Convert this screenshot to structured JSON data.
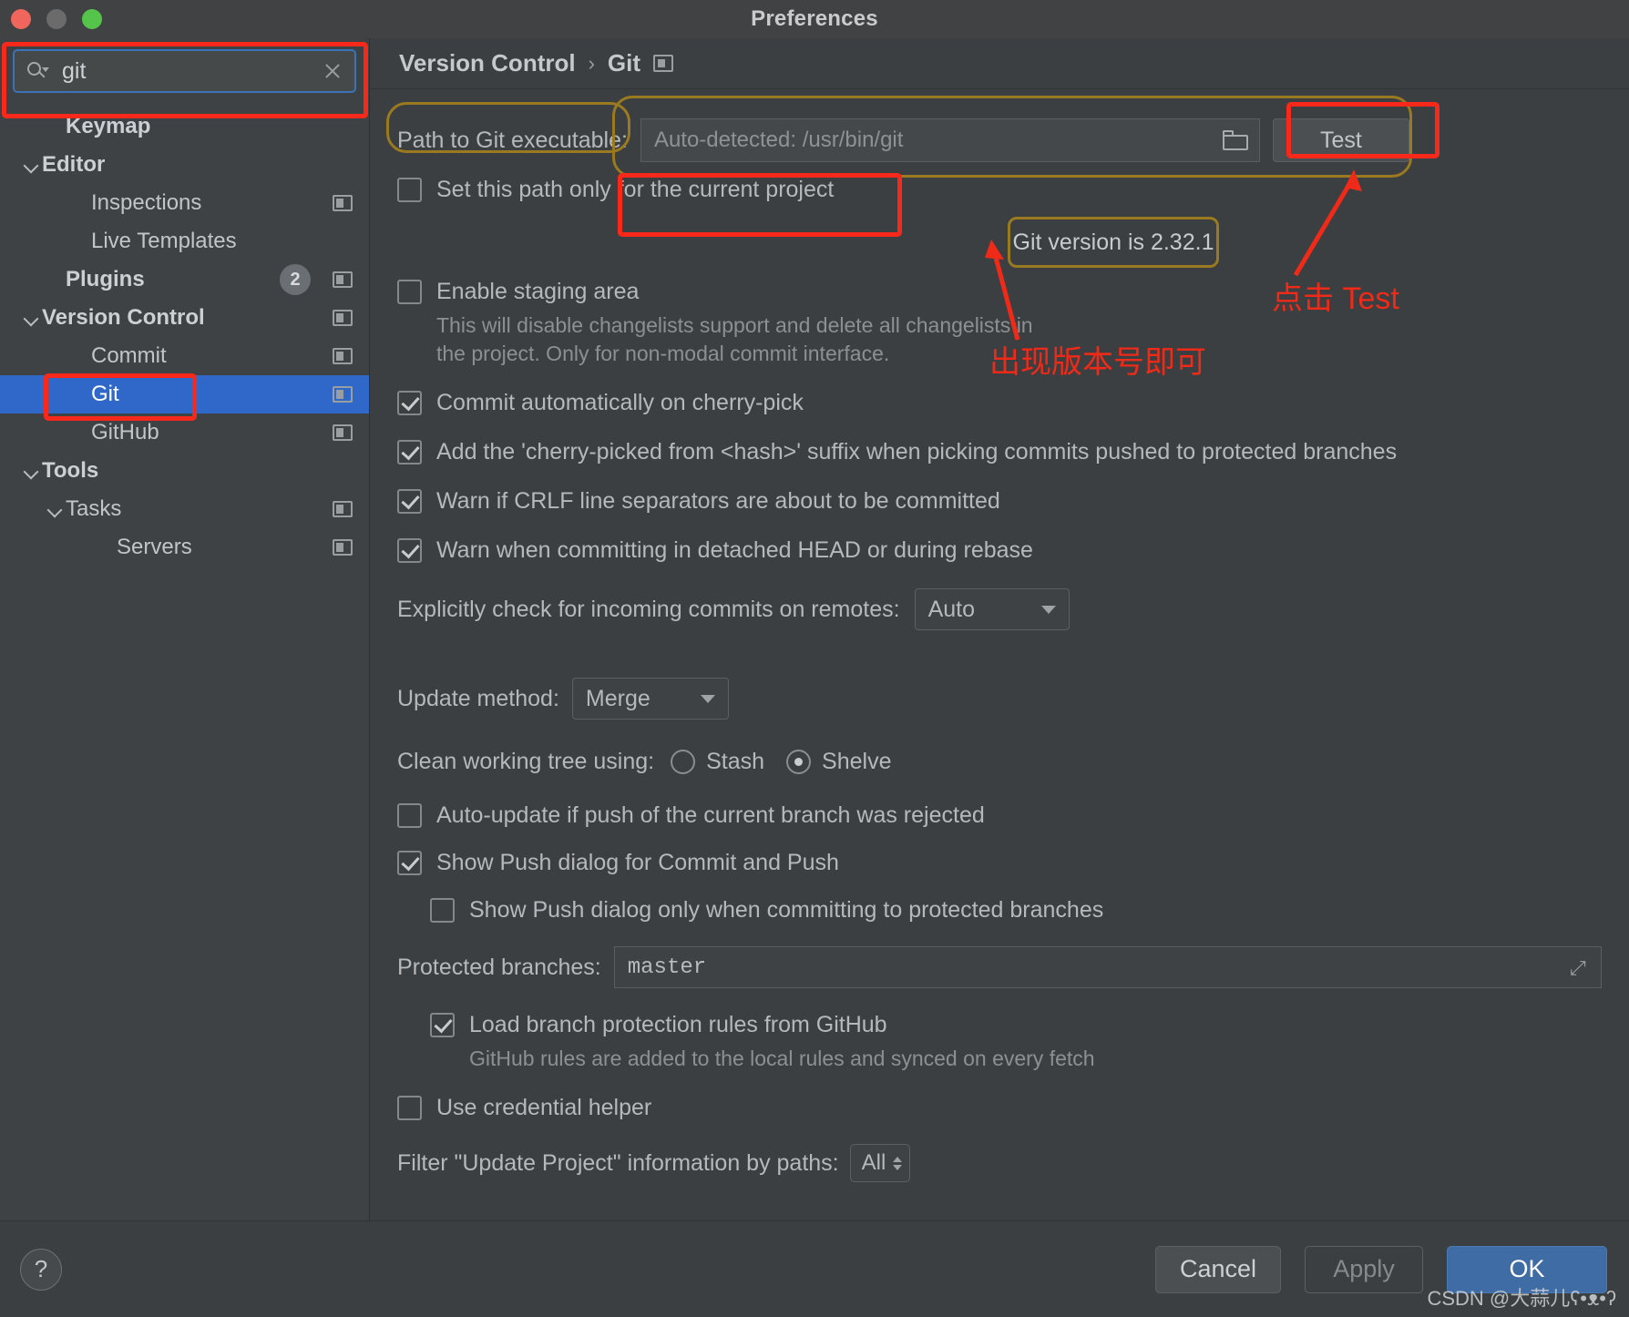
{
  "window": {
    "title": "Preferences",
    "traffic_lights": [
      "close",
      "minimize",
      "zoom"
    ]
  },
  "sidebar": {
    "search": {
      "value": "git",
      "placeholder": "",
      "icon": "search-icon",
      "clear_icon": "close-icon"
    },
    "items": [
      {
        "label": "Keymap",
        "level": 0,
        "bold": true,
        "chevron": false,
        "panel_icon": false,
        "selected": false
      },
      {
        "label": "Editor",
        "level": 0,
        "bold": true,
        "chevron": true,
        "panel_icon": false,
        "selected": false
      },
      {
        "label": "Inspections",
        "level": 1,
        "bold": false,
        "chevron": false,
        "panel_icon": true,
        "selected": false
      },
      {
        "label": "Live Templates",
        "level": 1,
        "bold": false,
        "chevron": false,
        "panel_icon": false,
        "selected": false
      },
      {
        "label": "Plugins",
        "level": 0,
        "bold": true,
        "chevron": false,
        "panel_icon": true,
        "selected": false,
        "badge": "2"
      },
      {
        "label": "Version Control",
        "level": 0,
        "bold": true,
        "chevron": true,
        "panel_icon": true,
        "selected": false
      },
      {
        "label": "Commit",
        "level": 1,
        "bold": false,
        "chevron": false,
        "panel_icon": true,
        "selected": false
      },
      {
        "label": "Git",
        "level": 1,
        "bold": false,
        "chevron": false,
        "panel_icon": true,
        "selected": true
      },
      {
        "label": "GitHub",
        "level": 1,
        "bold": false,
        "chevron": false,
        "panel_icon": true,
        "selected": false
      },
      {
        "label": "Tools",
        "level": 0,
        "bold": true,
        "chevron": true,
        "panel_icon": false,
        "selected": false
      },
      {
        "label": "Tasks",
        "level": 1,
        "bold": false,
        "chevron": true,
        "panel_icon": true,
        "selected": false
      },
      {
        "label": "Servers",
        "level": 2,
        "bold": false,
        "chevron": false,
        "panel_icon": true,
        "selected": false
      }
    ]
  },
  "breadcrumb": {
    "parent": "Version Control",
    "separator": "›",
    "current": "Git",
    "panel_icon": "panel-icon"
  },
  "main": {
    "path_label": "Path to Git executable:",
    "path_placeholder": "Auto-detected: /usr/bin/git",
    "path_value": "",
    "browse_icon": "folder-icon",
    "test_button": "Test",
    "set_path_only_label": "Set this path only for the current project",
    "set_path_only_checked": false,
    "git_version_message": "Git version is 2.32.1",
    "enable_staging_label": "Enable staging area",
    "enable_staging_checked": false,
    "enable_staging_help_line1": "This will disable changelists support and delete all changelists in",
    "enable_staging_help_line2": "the project. Only for non-modal commit interface.",
    "checkboxes": [
      {
        "label": "Commit automatically on cherry-pick",
        "checked": true
      },
      {
        "label": "Add the 'cherry-picked from <hash>' suffix when picking commits pushed to protected branches",
        "checked": true
      },
      {
        "label": "Warn if CRLF line separators are about to be committed",
        "checked": true
      },
      {
        "label": "Warn when committing in detached HEAD or during rebase",
        "checked": true
      }
    ],
    "incoming_label": "Explicitly check for incoming commits on remotes:",
    "incoming_value": "Auto",
    "update_method_label": "Update method:",
    "update_method_value": "Merge",
    "clean_tree_label": "Clean working tree using:",
    "clean_tree_option_stash": "Stash",
    "clean_tree_option_shelve": "Shelve",
    "clean_tree_selected": "Shelve",
    "auto_update_label": "Auto-update if push of the current branch was rejected",
    "auto_update_checked": false,
    "show_push_label": "Show Push dialog for Commit and Push",
    "show_push_checked": true,
    "show_push_protected_label": "Show Push dialog only when committing to protected branches",
    "show_push_protected_checked": false,
    "protected_branches_label": "Protected branches:",
    "protected_branches_value": "master",
    "load_rules_label": "Load branch protection rules from GitHub",
    "load_rules_checked": true,
    "load_rules_help": "GitHub rules are added to the local rules and synced on every fetch",
    "credential_helper_label": "Use credential helper",
    "credential_helper_checked": false,
    "filter_label": "Filter \"Update Project\" information by paths:",
    "filter_value": "All"
  },
  "footer": {
    "help": "?",
    "cancel": "Cancel",
    "apply": "Apply",
    "ok": "OK",
    "watermark": "CSDN @大蒜儿ʕ•ᴥ•ʔ"
  },
  "annotations": {
    "click_test": "点击 Test",
    "version_shown": "出现版本号即可",
    "accent_red": "#f8291a",
    "accent_gold": "#9a7a20",
    "selection_blue": "#2f68c9"
  }
}
